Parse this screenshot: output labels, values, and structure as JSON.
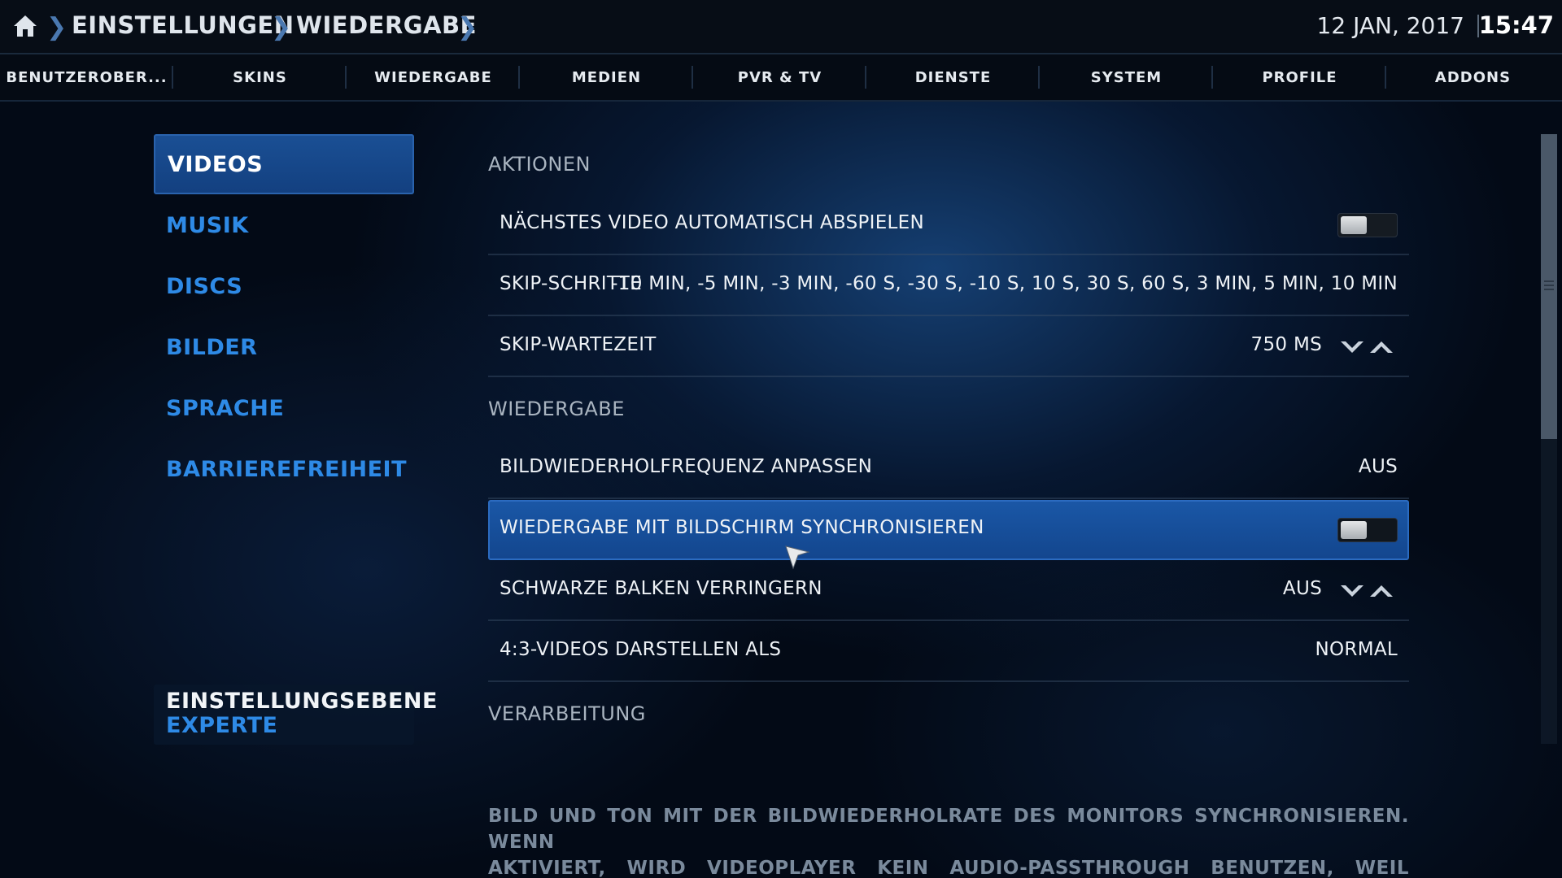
{
  "header": {
    "breadcrumb": [
      "EINSTELLUNGEN",
      "WIEDERGABE"
    ],
    "date": "12 JAN, 2017",
    "time": "15:47"
  },
  "tabs": [
    "BENUTZEROBER...",
    "SKINS",
    "WIEDERGABE",
    "MEDIEN",
    "PVR & TV",
    "DIENSTE",
    "SYSTEM",
    "PROFILE",
    "ADDONS"
  ],
  "categories": [
    "VIDEOS",
    "MUSIK",
    "DISCS",
    "BILDER",
    "SPRACHE",
    "BARRIEREFREIHEIT"
  ],
  "active_category": "VIDEOS",
  "settings_level": {
    "title": "EINSTELLUNGSEBENE",
    "value": "EXPERTE"
  },
  "groups": {
    "aktionen": "AKTIONEN",
    "wiedergabe": "WIEDERGABE",
    "verarbeitung": "VERARBEITUNG"
  },
  "settings": {
    "autoplay": {
      "label": "NÄCHSTES VIDEO AUTOMATISCH ABSPIELEN",
      "enabled": false
    },
    "skip_steps": {
      "label": "SKIP-SCHRITTE",
      "value": "-10 MIN, -5 MIN, -3 MIN, -60 S, -30 S, -10 S, 10 S, 30 S, 60 S, 3 MIN, 5 MIN, 10 MIN"
    },
    "skip_delay": {
      "label": "SKIP-WARTEZEIT",
      "value": "750 MS"
    },
    "refresh_rate": {
      "label": "BILDWIEDERHOLFREQUENZ ANPASSEN",
      "value": "AUS"
    },
    "sync_display": {
      "label": "WIEDERGABE MIT BILDSCHIRM SYNCHRONISIEREN",
      "enabled": false,
      "focused": true
    },
    "black_bars": {
      "label": "SCHWARZE BALKEN VERRINGERN",
      "value": "AUS"
    },
    "stretch_43": {
      "label": "4:3-VIDEOS DARSTELLEN ALS",
      "value": "NORMAL"
    }
  },
  "description": {
    "line1": "BILD UND TON MIT DER BILDWIEDERHOLRATE DES MONITORS SYNCHRONISIEREN. WENN",
    "line2": "AKTIVIERT, WIRD VIDEOPLAYER KEIN AUDIO-PASSTHROUGH BENUTZEN, WEIL HIERFÜR EINE"
  },
  "colors": {
    "accent": "#2e8ae6",
    "focus": "#1a57a6"
  },
  "icons": [
    "home-icon",
    "chevron-right-icon",
    "chevron-down-icon",
    "chevron-up-icon",
    "mouse-pointer-icon"
  ]
}
